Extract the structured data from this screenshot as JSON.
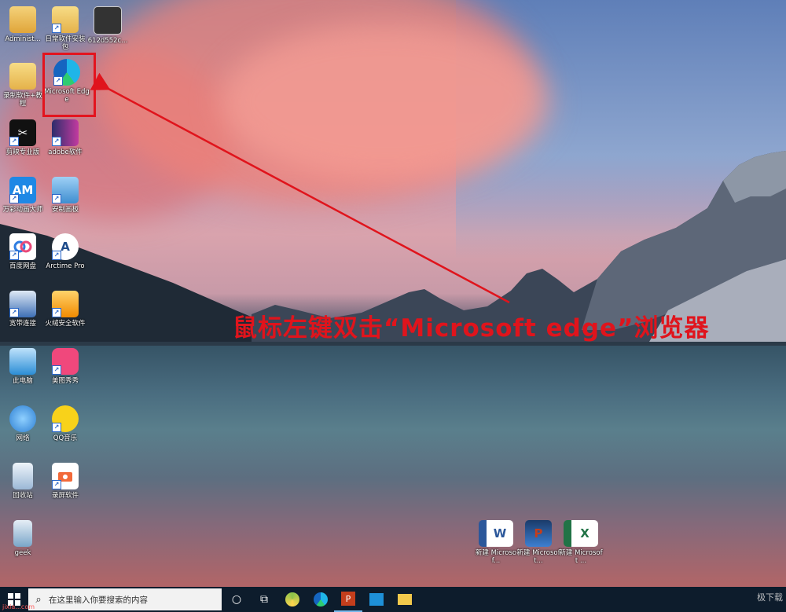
{
  "desktop_icons": [
    {
      "id": "administrator",
      "label": "Administ...",
      "color": "#e8b04a",
      "glyph": "👤"
    },
    {
      "id": "daily-software",
      "label": "日常软件安装包",
      "color": "#f2c94c",
      "glyph": ""
    },
    {
      "id": "image-file",
      "label": "612d552c...",
      "color": "#555555",
      "glyph": ""
    },
    {
      "id": "record-tutorial",
      "label": "录制软件+教程",
      "color": "#f2c94c",
      "glyph": ""
    },
    {
      "id": "microsoft-edge",
      "label": "Microsoft Edge",
      "color": "#1f8ad8",
      "glyph": ""
    },
    {
      "id": "capcut",
      "label": "剪映专业版",
      "color": "#111111",
      "glyph": "✂"
    },
    {
      "id": "adobe",
      "label": "adobe软件",
      "color": "#f2c94c",
      "glyph": ""
    },
    {
      "id": "am",
      "label": "万彩动画大师",
      "color": "#1e88e5",
      "glyph": "AM"
    },
    {
      "id": "anzhuo",
      "label": "安制画板",
      "color": "#4fa3e0",
      "glyph": ""
    },
    {
      "id": "baidu-netdisk",
      "label": "百度网盘",
      "color": "#ffffff",
      "glyph": ""
    },
    {
      "id": "arctime",
      "label": "Arctime Pro",
      "color": "#ffffff",
      "glyph": "A"
    },
    {
      "id": "broadband",
      "label": "宽带连接",
      "color": "#3d6fb6",
      "glyph": ""
    },
    {
      "id": "huorong",
      "label": "火绒安全软件",
      "color": "#f6a623",
      "glyph": ""
    },
    {
      "id": "this-pc",
      "label": "此电脑",
      "color": "#2c8ed6",
      "glyph": ""
    },
    {
      "id": "meitu",
      "label": "美图秀秀",
      "color": "#f0487c",
      "glyph": ""
    },
    {
      "id": "network",
      "label": "网络",
      "color": "#2d7fd3",
      "glyph": ""
    },
    {
      "id": "qq-music",
      "label": "QQ音乐",
      "color": "#f8d21a",
      "glyph": ""
    },
    {
      "id": "recycle-bin",
      "label": "回收站",
      "color": "#9bb8d6",
      "glyph": ""
    },
    {
      "id": "screen-recorder",
      "label": "录屏软件",
      "color": "#ffffff",
      "glyph": ""
    },
    {
      "id": "geek",
      "label": "geek",
      "color": "#7aa6c9",
      "glyph": ""
    },
    {
      "id": "new-word",
      "label": "新建 Microsof...",
      "color": "#2b579a",
      "glyph": "W"
    },
    {
      "id": "new-ppt",
      "label": "新建 Microsoft...",
      "color": "#c43e1c",
      "glyph": "P"
    },
    {
      "id": "new-excel",
      "label": "新建 Microsoft ...",
      "color": "#217346",
      "glyph": "X"
    }
  ],
  "annotation": {
    "text": "鼠标左键双击“Microsoft edge”浏览器"
  },
  "taskbar": {
    "search_placeholder": "在这里输入你要搜索的内容",
    "items": [
      {
        "id": "cortana",
        "glyph": "○"
      },
      {
        "id": "task-view",
        "glyph": "⧉"
      },
      {
        "id": "app-green",
        "glyph": ""
      },
      {
        "id": "edge",
        "glyph": ""
      },
      {
        "id": "powerpoint",
        "glyph": "P"
      },
      {
        "id": "app-blue",
        "glyph": ""
      },
      {
        "id": "file-explorer",
        "glyph": ""
      }
    ],
    "watermark": "极下载",
    "site_tag": "jixia...com"
  },
  "colors": {
    "highlight": "#e3141e",
    "annotation": "#e0141c",
    "taskbar": "#0d1c2c"
  }
}
